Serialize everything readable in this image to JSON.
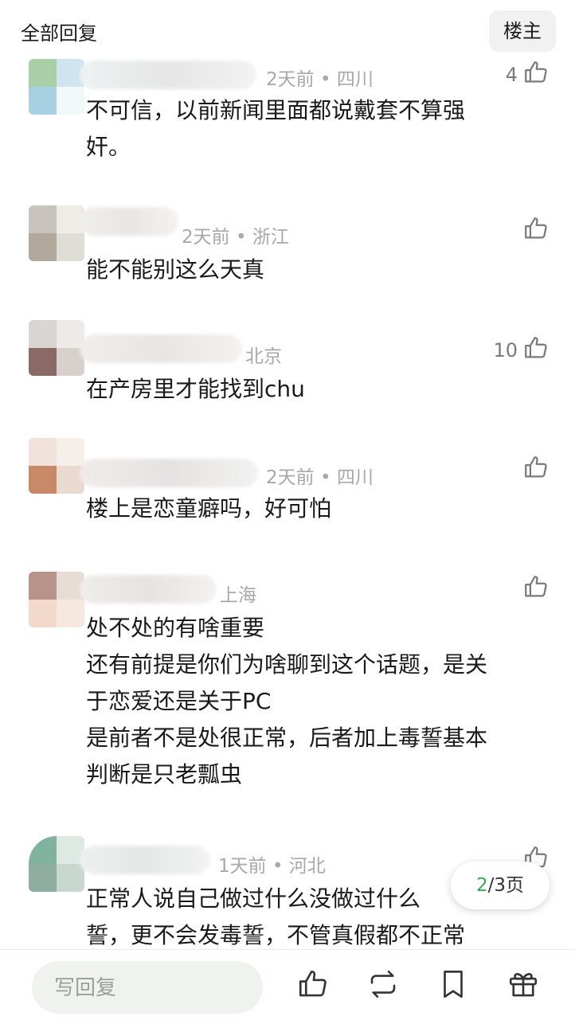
{
  "header": {
    "title": "全部回复",
    "op_label": "楼主"
  },
  "comments": [
    {
      "meta": "2天前 • 四川",
      "likes": "4",
      "lines": [
        "不可信，以前新闻里面都说戴套不算强",
        "奸。"
      ],
      "avatar_colors": [
        "#a9cfa9",
        "#cfe4ef",
        "#a8d0e3",
        "#f2f7f9"
      ]
    },
    {
      "meta": "2天前 • 浙江",
      "likes": "",
      "lines": [
        "能不能别这么天真"
      ],
      "avatar_colors": [
        "#c8c3bd",
        "#efebe6",
        "#b2a99c",
        "#e0dcd6"
      ]
    },
    {
      "meta": "北京",
      "likes": "10",
      "lines": [
        "在产房里才能找到chu"
      ],
      "avatar_colors": [
        "#d9d5d2",
        "#eeeae8",
        "#8a6a64",
        "#d8d0cd"
      ]
    },
    {
      "meta": "2天前 • 四川",
      "likes": "",
      "lines": [
        "楼上是恋童癖吗，好可怕"
      ],
      "avatar_colors": [
        "#f1e3dc",
        "#f6efe9",
        "#c88a66",
        "#ead9cf"
      ]
    },
    {
      "meta": "上海",
      "likes": "",
      "lines": [
        "处不处的有啥重要",
        "还有前提是你们为啥聊到这个话题，是关",
        "于恋爱还是关于PC",
        "是前者不是处很正常，后者加上毒誓基本",
        "判断是只老瓢虫"
      ],
      "avatar_colors": [
        "#b8938a",
        "#e7dcd6",
        "#f3d9c9",
        "#f6e8de"
      ]
    },
    {
      "meta": "1天前 • 河北",
      "likes": "",
      "lines": [
        "正常人说自己做过什么没做过什么",
        "誓，更不会发毒誓，不管真假都不正常"
      ],
      "avatar_colors": [
        "#7fb39e",
        "#dfe9e4",
        "#8fae9f",
        "#c8d8d0"
      ]
    }
  ],
  "pager": {
    "current": "2",
    "total": "/3页"
  },
  "bottombar": {
    "reply_placeholder": "写回复"
  },
  "icons": [
    "thumb-up-icon",
    "repost-icon",
    "bookmark-icon",
    "gift-icon"
  ]
}
